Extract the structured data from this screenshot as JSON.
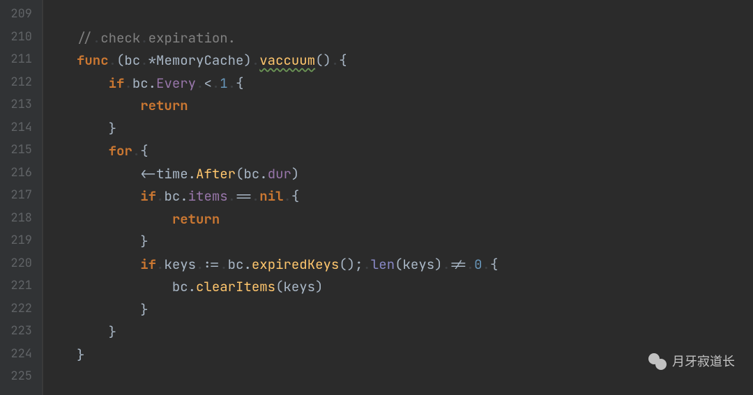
{
  "gutter": {
    "start": 209,
    "end": 225
  },
  "code": {
    "lines": [
      {
        "n": 209,
        "tokens": []
      },
      {
        "n": 210,
        "tokens": [
          {
            "t": "comment",
            "v": "//"
          },
          {
            "t": "ws",
            "v": "."
          },
          {
            "t": "comment",
            "v": "check"
          },
          {
            "t": "ws",
            "v": "."
          },
          {
            "t": "comment",
            "v": "expiration."
          }
        ]
      },
      {
        "n": 211,
        "tokens": [
          {
            "t": "keyword",
            "v": "func"
          },
          {
            "t": "ws",
            "v": "."
          },
          {
            "t": "punct",
            "v": "("
          },
          {
            "t": "ident",
            "v": "bc"
          },
          {
            "t": "ws",
            "v": "."
          },
          {
            "t": "op",
            "v": "*"
          },
          {
            "t": "type",
            "v": "MemoryCache"
          },
          {
            "t": "punct",
            "v": ")"
          },
          {
            "t": "ws",
            "v": "."
          },
          {
            "t": "funcname",
            "v": "vaccuum"
          },
          {
            "t": "punct",
            "v": "()"
          },
          {
            "t": "ws",
            "v": "."
          },
          {
            "t": "punct",
            "v": "{"
          }
        ]
      },
      {
        "n": 212,
        "tokens": [
          {
            "t": "indent",
            "v": 1
          },
          {
            "t": "keyword",
            "v": "if"
          },
          {
            "t": "ws",
            "v": "."
          },
          {
            "t": "ident",
            "v": "bc"
          },
          {
            "t": "punct",
            "v": "."
          },
          {
            "t": "field",
            "v": "Every"
          },
          {
            "t": "ws",
            "v": "."
          },
          {
            "t": "op",
            "v": "<"
          },
          {
            "t": "ws",
            "v": "."
          },
          {
            "t": "num",
            "v": "1"
          },
          {
            "t": "ws",
            "v": "."
          },
          {
            "t": "punct",
            "v": "{"
          }
        ]
      },
      {
        "n": 213,
        "tokens": [
          {
            "t": "indent",
            "v": 2
          },
          {
            "t": "keyword",
            "v": "return"
          }
        ]
      },
      {
        "n": 214,
        "tokens": [
          {
            "t": "indent",
            "v": 1
          },
          {
            "t": "punct",
            "v": "}"
          }
        ]
      },
      {
        "n": 215,
        "tokens": [
          {
            "t": "indent",
            "v": 1
          },
          {
            "t": "keyword",
            "v": "for"
          },
          {
            "t": "ws",
            "v": "."
          },
          {
            "t": "punct",
            "v": "{"
          }
        ]
      },
      {
        "n": 216,
        "tokens": [
          {
            "t": "indent",
            "v": 2
          },
          {
            "t": "op",
            "v": "<-"
          },
          {
            "t": "ident",
            "v": "time"
          },
          {
            "t": "punct",
            "v": "."
          },
          {
            "t": "call",
            "v": "After"
          },
          {
            "t": "punct",
            "v": "("
          },
          {
            "t": "ident",
            "v": "bc"
          },
          {
            "t": "punct",
            "v": "."
          },
          {
            "t": "field",
            "v": "dur"
          },
          {
            "t": "punct",
            "v": ")"
          }
        ]
      },
      {
        "n": 217,
        "tokens": [
          {
            "t": "indent",
            "v": 2
          },
          {
            "t": "keyword",
            "v": "if"
          },
          {
            "t": "ws",
            "v": "."
          },
          {
            "t": "ident",
            "v": "bc"
          },
          {
            "t": "punct",
            "v": "."
          },
          {
            "t": "field",
            "v": "items"
          },
          {
            "t": "ws",
            "v": "."
          },
          {
            "t": "op",
            "v": "=="
          },
          {
            "t": "ws",
            "v": "."
          },
          {
            "t": "keyword",
            "v": "nil"
          },
          {
            "t": "ws",
            "v": "."
          },
          {
            "t": "punct",
            "v": "{"
          }
        ]
      },
      {
        "n": 218,
        "tokens": [
          {
            "t": "indent",
            "v": 3
          },
          {
            "t": "keyword",
            "v": "return"
          }
        ]
      },
      {
        "n": 219,
        "tokens": [
          {
            "t": "indent",
            "v": 2
          },
          {
            "t": "punct",
            "v": "}"
          }
        ]
      },
      {
        "n": 220,
        "tokens": [
          {
            "t": "indent",
            "v": 2
          },
          {
            "t": "keyword",
            "v": "if"
          },
          {
            "t": "ws",
            "v": "."
          },
          {
            "t": "ident",
            "v": "keys"
          },
          {
            "t": "ws",
            "v": "."
          },
          {
            "t": "op",
            "v": ":="
          },
          {
            "t": "ws",
            "v": "."
          },
          {
            "t": "ident",
            "v": "bc"
          },
          {
            "t": "punct",
            "v": "."
          },
          {
            "t": "call",
            "v": "expiredKeys"
          },
          {
            "t": "punct",
            "v": "();"
          },
          {
            "t": "ws",
            "v": "."
          },
          {
            "t": "builtin",
            "v": "len"
          },
          {
            "t": "punct",
            "v": "("
          },
          {
            "t": "ident",
            "v": "keys"
          },
          {
            "t": "punct",
            "v": ")"
          },
          {
            "t": "ws",
            "v": "."
          },
          {
            "t": "op",
            "v": "!="
          },
          {
            "t": "ws",
            "v": "."
          },
          {
            "t": "num",
            "v": "0"
          },
          {
            "t": "ws",
            "v": "."
          },
          {
            "t": "punct",
            "v": "{"
          }
        ]
      },
      {
        "n": 221,
        "tokens": [
          {
            "t": "indent",
            "v": 3
          },
          {
            "t": "ident",
            "v": "bc"
          },
          {
            "t": "punct",
            "v": "."
          },
          {
            "t": "call",
            "v": "clearItems"
          },
          {
            "t": "punct",
            "v": "("
          },
          {
            "t": "ident",
            "v": "keys"
          },
          {
            "t": "punct",
            "v": ")"
          }
        ]
      },
      {
        "n": 222,
        "tokens": [
          {
            "t": "indent",
            "v": 2
          },
          {
            "t": "punct",
            "v": "}"
          }
        ]
      },
      {
        "n": 223,
        "tokens": [
          {
            "t": "indent",
            "v": 1
          },
          {
            "t": "punct",
            "v": "}"
          }
        ]
      },
      {
        "n": 224,
        "tokens": [
          {
            "t": "punct",
            "v": "}"
          }
        ]
      },
      {
        "n": 225,
        "tokens": []
      }
    ]
  },
  "watermark": {
    "text": "月牙寂道长"
  }
}
